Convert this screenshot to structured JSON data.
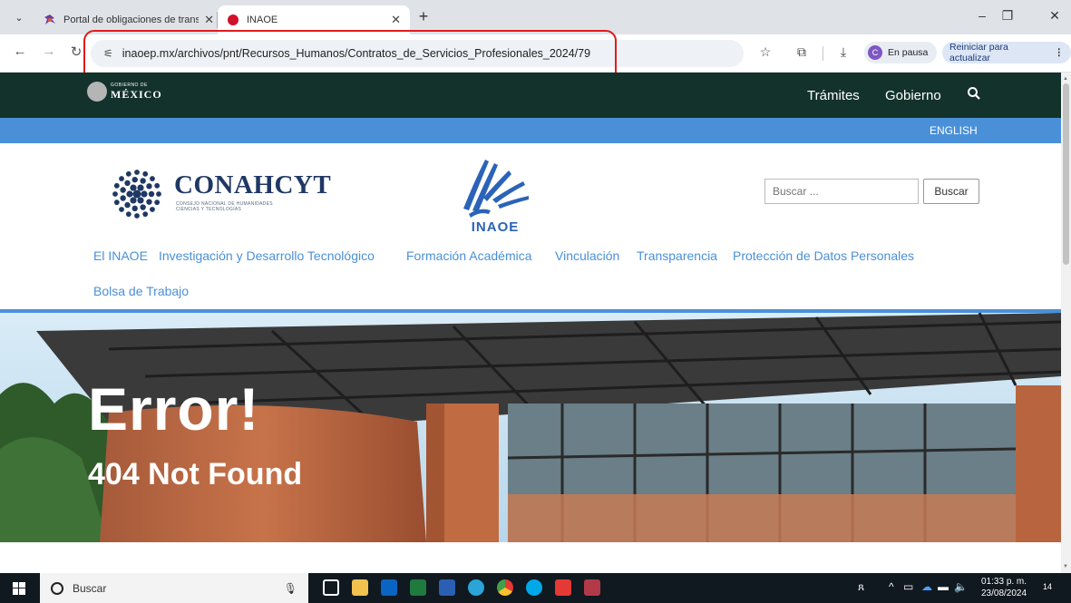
{
  "browser": {
    "tabs": [
      {
        "title": "Portal de obligaciones de trans",
        "active": false
      },
      {
        "title": "INAOE",
        "active": true
      }
    ],
    "address": "inaoep.mx/archivos/pnt/Recursos_Humanos/Contratos_de_Servicios_Profesionales_2024/79",
    "profile_initial": "C",
    "profile_label": "En pausa",
    "restart_label": "Reiniciar para actualizar"
  },
  "gov_header": {
    "logo_small": "GOBIERNO DE",
    "logo_big": "MÉXICO",
    "nav": [
      "Trámites",
      "Gobierno"
    ],
    "language_link": "ENGLISH"
  },
  "branding": {
    "conahcyt_name": "CONAHCYT",
    "conahcyt_sub_1": "CONSEJO NACIONAL DE HUMANIDADES",
    "conahcyt_sub_2": "CIENCIAS Y TECNOLOGÍAS",
    "inaoe_name": "INAOE"
  },
  "site_search": {
    "placeholder": "Buscar ...",
    "button": "Buscar"
  },
  "main_nav": [
    "El INAOE",
    "Investigación y Desarrollo Tecnológico",
    "Formación Académica",
    "Vinculación",
    "Transparencia",
    "Protección de Datos Personales",
    "Bolsa de Trabajo"
  ],
  "hero": {
    "title": "Error!",
    "subtitle": "404 Not Found"
  },
  "taskbar": {
    "search_label": "Buscar",
    "time": "01:33 p. m.",
    "date": "23/08/2024",
    "notifications": "14"
  },
  "colors": {
    "gov_green": "#13322b",
    "accent_blue": "#4a90d9",
    "conahcyt_navy": "#1f3864",
    "highlight_red": "#e01b1b"
  }
}
